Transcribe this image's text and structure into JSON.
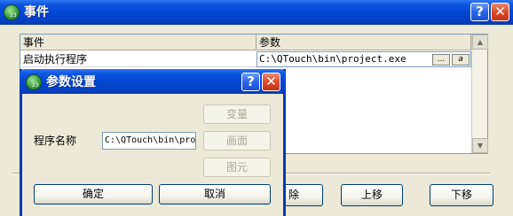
{
  "main_window": {
    "title": "事件",
    "help_glyph": "?",
    "close_glyph": "✕"
  },
  "table": {
    "columns": [
      "事件",
      "参数"
    ],
    "rows": [
      {
        "event": "启动执行程序",
        "param": "C:\\QTouch\\bin\\project.exe"
      }
    ],
    "browse_label": "...",
    "edit_glyph": "a",
    "scroll_up": "▲",
    "scroll_down": "▼"
  },
  "actions": {
    "delete_partial": "除",
    "move_up": "上移",
    "move_down": "下移"
  },
  "dialog": {
    "title": "参数设置",
    "help_glyph": "?",
    "close_glyph": "✕",
    "program_label": "程序名称",
    "program_value": "C:\\QTouch\\bin\\project.exe",
    "variable_button": "变量",
    "screen_button": "画面",
    "element_button": "图元",
    "ok_button": "确定",
    "cancel_button": "取消"
  }
}
